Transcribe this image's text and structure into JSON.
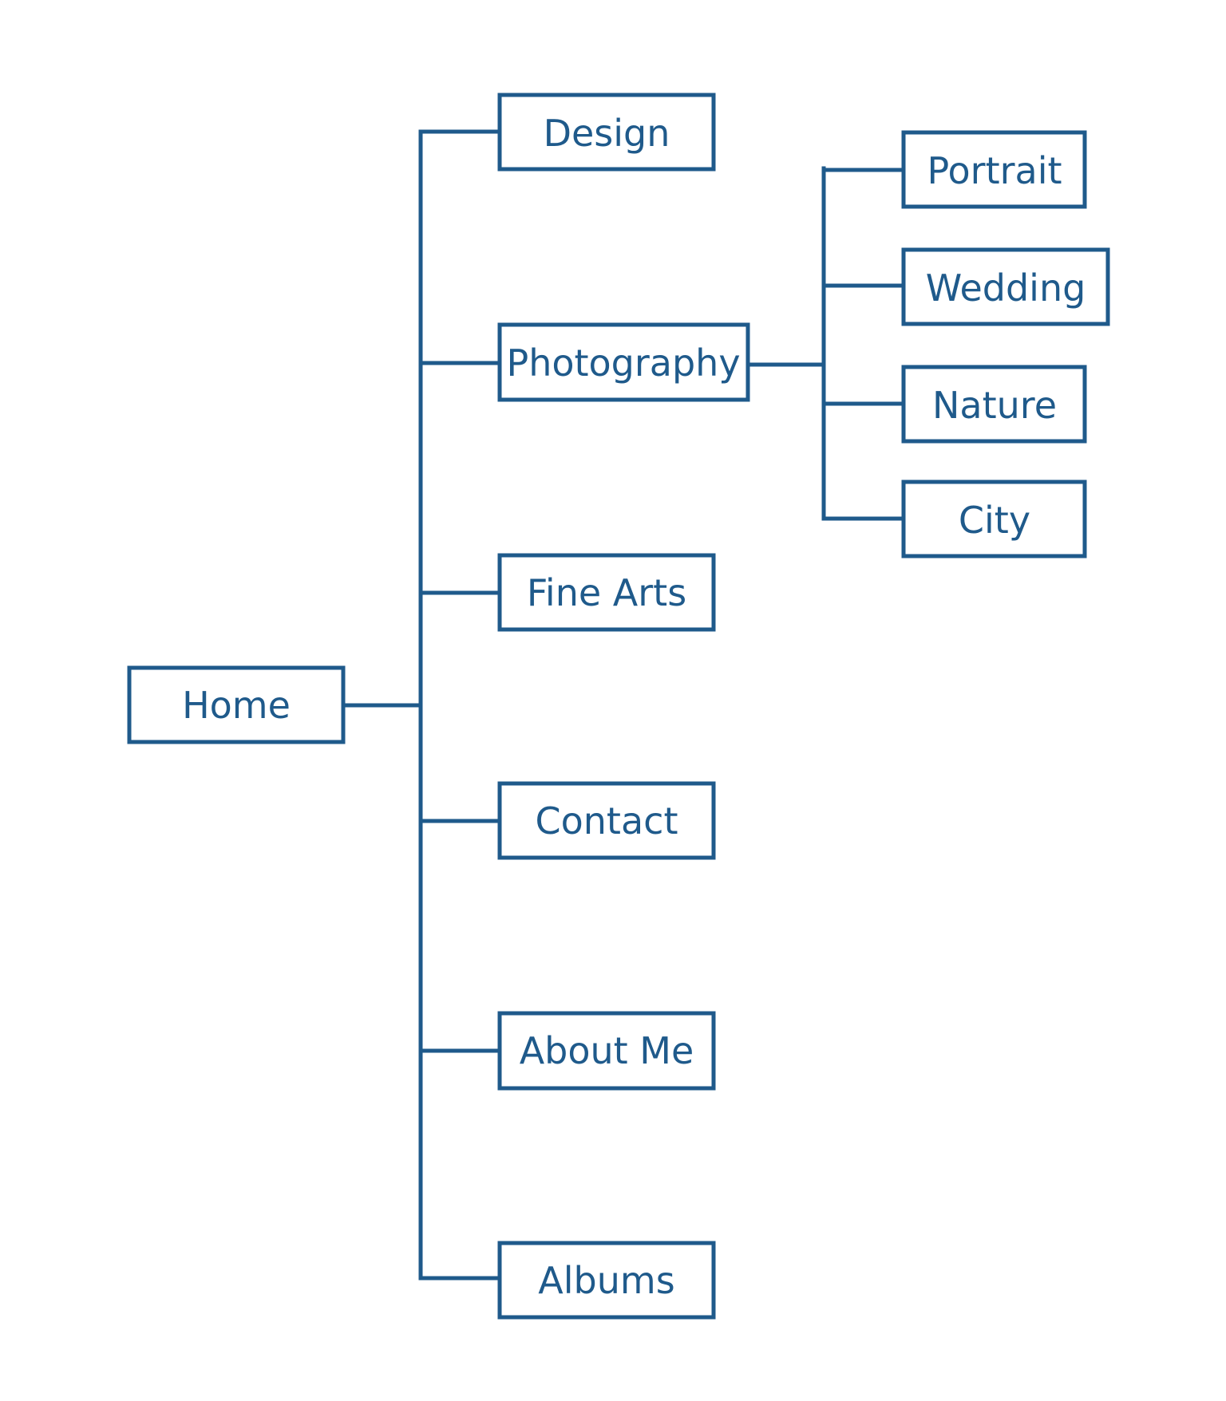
{
  "diagram": {
    "stroke_color": "#1f5a8b",
    "root": "Home",
    "level1": [
      "Design",
      "Photography",
      "Fine Arts",
      "Contact",
      "About Me",
      "Albums"
    ],
    "photography_children": [
      "Portrait",
      "Wedding",
      "Nature",
      "City"
    ]
  }
}
